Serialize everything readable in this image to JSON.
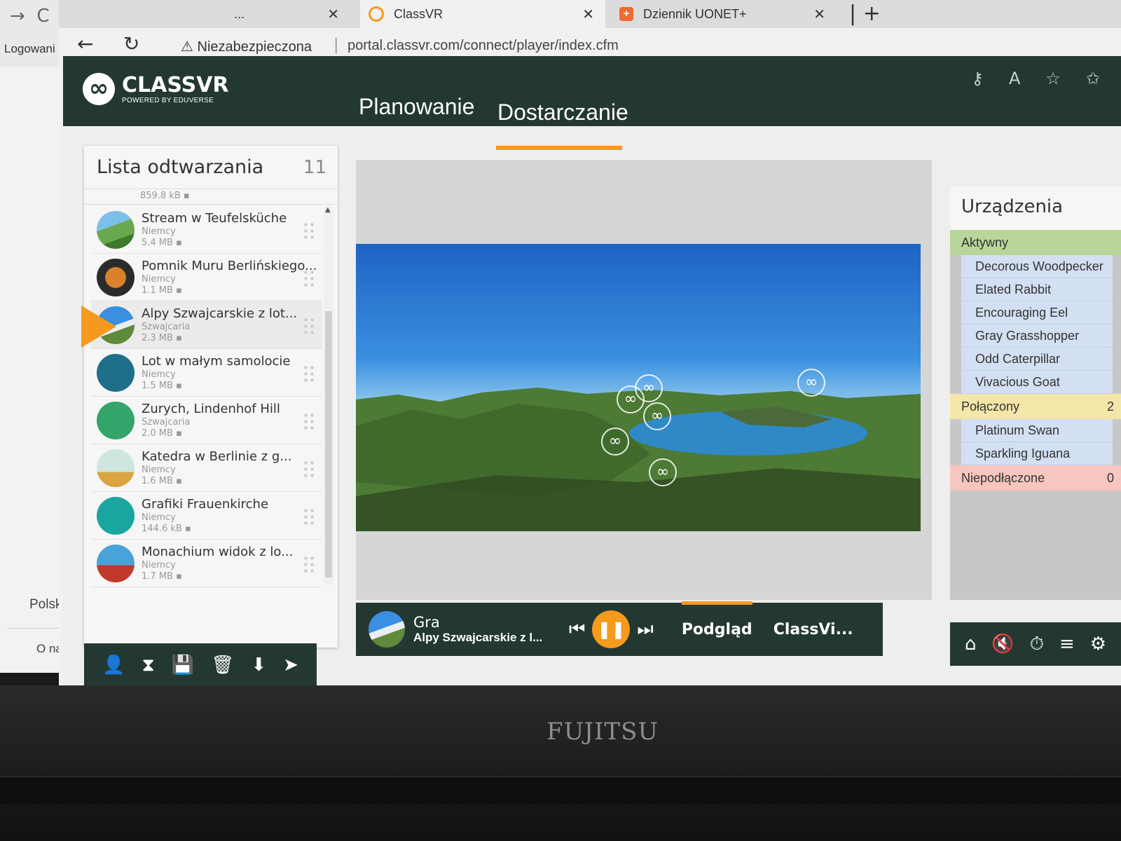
{
  "outer_window": {
    "sidebar_label": "Logowani",
    "footer_links": [
      "Polska",
      "O nas"
    ]
  },
  "browser": {
    "tabs": [
      {
        "title": "...",
        "active": false
      },
      {
        "title": "ClassVR",
        "active": true
      },
      {
        "title": "Dziennik UONET+",
        "active": false
      }
    ],
    "security_label": "Niezabezpieczona",
    "url": "portal.classvr.com/connect/player/index.cfm"
  },
  "app": {
    "logo_name": "CLASSVR",
    "logo_sub": "POWERED BY EDUVERSE",
    "nav": [
      {
        "label": "Planowanie",
        "active": false
      },
      {
        "label": "Dostarczanie",
        "active": true
      }
    ]
  },
  "playlist": {
    "title": "Lista odtwarzania",
    "count": "11",
    "top_partial_size": "859.8 kB",
    "items": [
      {
        "name": "Stream w Teufelsküche",
        "country": "Niemcy",
        "size": "5.4 MB",
        "thumb": "river"
      },
      {
        "name": "Pomnik Muru Berlińskiego...",
        "country": "Niemcy",
        "size": "1.1 MB",
        "thumb": "art"
      },
      {
        "name": "Alpy Szwajcarskie z lot...",
        "country": "Szwajcaria",
        "size": "2.3 MB",
        "thumb": "alps",
        "selected": true
      },
      {
        "name": "Lot w małym samolocie",
        "country": "Niemcy",
        "size": "1.5 MB",
        "thumb": "plane"
      },
      {
        "name": "Zurych, Lindenhof Hill",
        "country": "Szwajcaria",
        "size": "2.0 MB",
        "thumb": "city"
      },
      {
        "name": "Katedra w Berlinie z g...",
        "country": "Niemcy",
        "size": "1.6 MB",
        "thumb": "cathedral"
      },
      {
        "name": "Grafiki Frauenkirche",
        "country": "Niemcy",
        "size": "144.6 kB",
        "thumb": "easel"
      },
      {
        "name": "Monachium widok z lo...",
        "country": "Niemcy",
        "size": "1.7 MB",
        "thumb": "munich"
      }
    ]
  },
  "player": {
    "mode": "Gra",
    "current": "Alpy Szwajcarskie z l...",
    "tabs": [
      {
        "label": "Podgląd",
        "active": true
      },
      {
        "label": "ClassVi...",
        "active": false
      }
    ]
  },
  "devices": {
    "title": "Urządzenia",
    "groups": [
      {
        "label": "Aktywny",
        "count": "",
        "kind": "active",
        "devices": [
          "Decorous Woodpecker",
          "Elated Rabbit",
          "Encouraging Eel",
          "Gray Grasshopper",
          "Odd Caterpillar",
          "Vivacious Goat"
        ]
      },
      {
        "label": "Połączony",
        "count": "2",
        "kind": "connected",
        "devices": [
          "Platinum Swan",
          "Sparkling Iguana"
        ]
      },
      {
        "label": "Niepodłączone",
        "count": "0",
        "kind": "disconnected",
        "devices": []
      }
    ]
  },
  "laptop_brand": "FUJITSU",
  "colors": {
    "header": "#233833",
    "accent": "#f59a1d",
    "active_group": "#b8d69a",
    "connected_group": "#f4e6a8",
    "disconnected_group": "#f7c6bf",
    "device_row": "#d3dff2"
  }
}
